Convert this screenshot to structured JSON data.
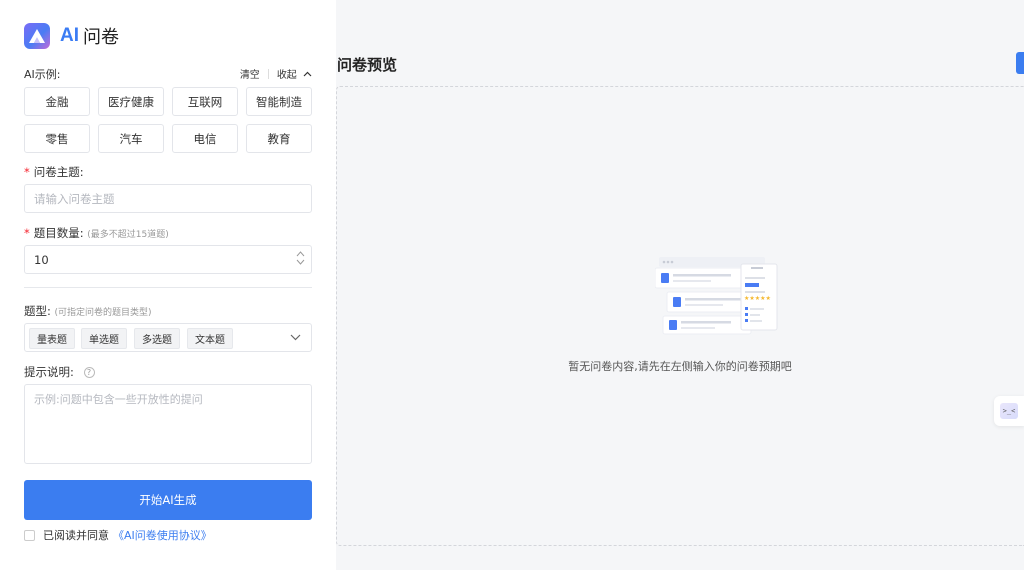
{
  "brand": {
    "ai": "AI",
    "name": "问卷",
    "accent": "#3b7df0"
  },
  "examples": {
    "label": "AI示例:",
    "clear": "清空",
    "collapse": "收起",
    "categories": [
      "金融",
      "医疗健康",
      "互联网",
      "智能制造",
      "零售",
      "汽车",
      "电信",
      "教育"
    ]
  },
  "form": {
    "topic": {
      "label": "问卷主题:",
      "placeholder": "请输入问卷主题",
      "value": ""
    },
    "count": {
      "label": "题目数量:",
      "hint": "(最多不超过15道题)",
      "value": "10"
    },
    "types": {
      "label": "题型:",
      "hint": "(可指定问卷的题目类型)",
      "tags": [
        "量表题",
        "单选题",
        "多选题",
        "文本题"
      ]
    },
    "prompt": {
      "label": "提示说明:",
      "placeholder": "示例:问题中包含一些开放性的提问"
    },
    "submit": "开始AI生成",
    "agree": {
      "text": "已阅读并同意",
      "link": "《AI问卷使用协议》",
      "checked": false
    }
  },
  "preview": {
    "title": "问卷预览",
    "empty_text": "暂无问卷内容,请先在左侧输入你的问卷预期吧"
  },
  "icons": {
    "logo": "logo-icon",
    "chevron_up": "chevron-up-icon",
    "chevron_down": "chevron-down-icon",
    "help": "question-circle-icon",
    "assistant": "assistant-face-icon"
  }
}
